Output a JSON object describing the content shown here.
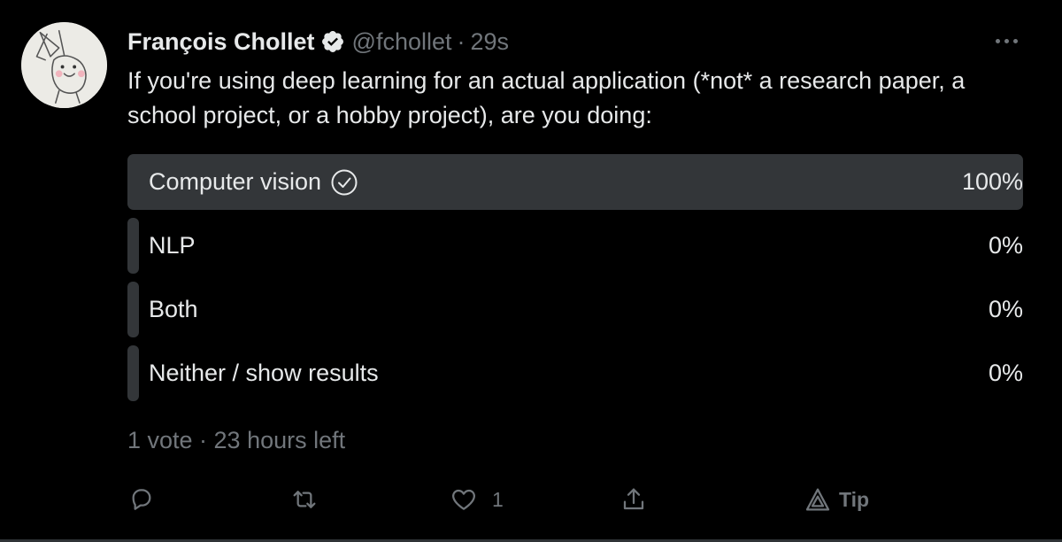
{
  "tweet": {
    "author_name": "François Chollet",
    "handle": "@fchollet",
    "separator": "·",
    "time": "29s",
    "text": "If you're using deep learning for an actual application (*not* a research paper, a school project, or a hobby project), are you doing:"
  },
  "poll": {
    "options": [
      {
        "label": "Computer vision",
        "percent_label": "100%",
        "percent": 100,
        "selected": true
      },
      {
        "label": "NLP",
        "percent_label": "0%",
        "percent": 0,
        "selected": false
      },
      {
        "label": "Both",
        "percent_label": "0%",
        "percent": 0,
        "selected": false
      },
      {
        "label": "Neither / show results",
        "percent_label": "0%",
        "percent": 0,
        "selected": false
      }
    ],
    "meta": "1 vote · 23 hours left"
  },
  "actions": {
    "like_count": "1",
    "tip_label": "Tip"
  },
  "icons": {
    "verified": "verified-badge-icon",
    "more": "more-dots-icon",
    "check": "check-circle-icon",
    "reply": "reply-icon",
    "retweet": "retweet-icon",
    "like": "heart-icon",
    "share": "share-icon",
    "tip": "tip-icon"
  },
  "colors": {
    "background": "#000000",
    "text": "#e7e9ea",
    "muted": "#71767b",
    "poll_fill": "#333639"
  }
}
